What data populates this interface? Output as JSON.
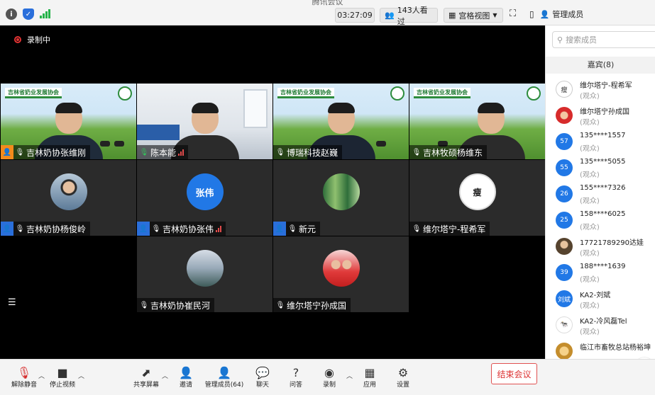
{
  "window": {
    "title": "腾讯会议"
  },
  "topbar": {
    "timer": "03:27:09",
    "viewers": "143人看过",
    "view_mode": "宫格视图",
    "manage_members": "管理成员"
  },
  "stage": {
    "recording_label": "录制中",
    "tiles": [
      {
        "name": "吉林奶协张维刚",
        "banner": "吉林省奶业发展协会"
      },
      {
        "name": "陈本能"
      },
      {
        "name": "博瑞科技赵巍",
        "banner": "吉林省奶业发展协会"
      },
      {
        "name": "吉林牧硕杨维东",
        "banner": "吉林省奶业发展协会"
      },
      {
        "name": "吉林奶协杨俊岭"
      },
      {
        "name": "吉林奶协张伟",
        "avatar_text": "张伟"
      },
      {
        "name": "新元"
      },
      {
        "name": "维尔塔宁-程希军",
        "avatar_text": "瘦"
      },
      {
        "name": "吉林奶协崔民河"
      },
      {
        "name": "维尔塔宁孙成国"
      }
    ]
  },
  "sidebar": {
    "search_placeholder": "搜索成员",
    "section_title": "嘉宾(8)",
    "members": [
      {
        "name": "维尔塔宁-程希军",
        "role": "(观众)",
        "avatar": "瘦"
      },
      {
        "name": "维尔塔宁孙成国",
        "role": "(观众)",
        "avatar": ""
      },
      {
        "name": "135****1557",
        "role": "(观众)",
        "avatar": "57"
      },
      {
        "name": "135****5055",
        "role": "(观众)",
        "avatar": "55"
      },
      {
        "name": "155****7326",
        "role": "(观众)",
        "avatar": "26"
      },
      {
        "name": "158****6025",
        "role": "(观众)",
        "avatar": "25"
      },
      {
        "name": "17721789290达娃",
        "role": "(观众)",
        "avatar": ""
      },
      {
        "name": "188****1639",
        "role": "(观众)",
        "avatar": "39"
      },
      {
        "name": "KA2-刘斌",
        "role": "(观众)",
        "avatar": "刘斌"
      },
      {
        "name": "KA2-冷风磊Tel",
        "role": "(观众)",
        "avatar": ""
      },
      {
        "name": "临江市畜牧总站杨裕坤",
        "role": "",
        "avatar": ""
      }
    ]
  },
  "toolbar": {
    "unmute": "解除静音",
    "stop_video": "停止视频",
    "share_screen": "共享屏幕",
    "invite": "邀请",
    "manage_members": "管理成员(64)",
    "chat": "聊天",
    "qa": "问答",
    "record": "录制",
    "apps": "应用",
    "settings": "设置",
    "end_meeting": "结束会议"
  },
  "colors": {
    "accent": "#2178e6",
    "danger": "#d62b2b",
    "banner_green": "#2d8c3c"
  }
}
